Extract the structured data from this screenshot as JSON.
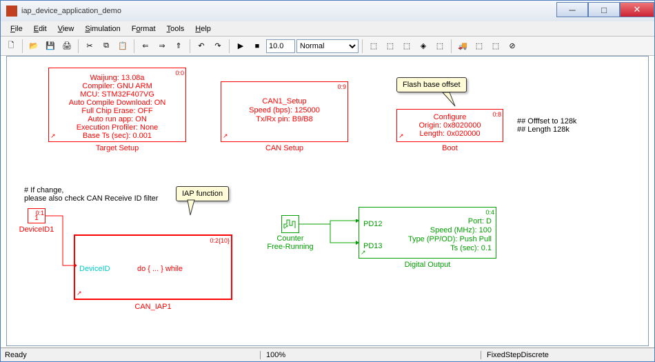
{
  "window": {
    "title": "iap_device_application_demo"
  },
  "menu": {
    "file": "File",
    "edit": "Edit",
    "view": "View",
    "simulation": "Simulation",
    "format": "Format",
    "tools": "Tools",
    "help": "Help"
  },
  "toolbar": {
    "simtime": "10.0",
    "mode": "Normal"
  },
  "status": {
    "ready": "Ready",
    "percent": "100%",
    "solver": "FixedStepDiscrete"
  },
  "blocks": {
    "target": {
      "idx": "0:0",
      "l1": "Waijung: 13.08a",
      "l2": "Compiler: GNU ARM",
      "l3": "MCU: STM32F407VG",
      "l4": "Auto Compile Download: ON",
      "l5": "Full Chip Erase: OFF",
      "l6": "Auto run app: ON",
      "l7": "Execution Profiler: None",
      "l8": "Base Ts (sec): 0.001",
      "label": "Target Setup"
    },
    "can": {
      "idx": "0:9",
      "l1": "CAN1_Setup",
      "l2": "Speed (bps): 125000",
      "l3": "Tx/Rx pin: B9/B8",
      "label": "CAN Setup"
    },
    "boot": {
      "idx": "0:8",
      "l1": "Configure",
      "l2": "Origin: 0x8020000",
      "l3": "Length: 0x020000",
      "label": "Boot"
    },
    "bootnote": {
      "l1": "## Offfset to 128k",
      "l2": "## Length 128k"
    },
    "callout1": "Flash base offset",
    "note1": {
      "l1": "# If change,",
      "l2": "please also check CAN Receive ID filter"
    },
    "deviceid": {
      "idx": "0:1",
      "val": "1",
      "label": "DeviceID1"
    },
    "callout2": "IAP function",
    "caniap": {
      "idx": "0:2{10}",
      "port": "DeviceID",
      "body": "do { ... } while",
      "label": "CAN_IAP1"
    },
    "counter": {
      "l1": "Counter",
      "l2": "Free-Running"
    },
    "digout": {
      "idx": "0:4",
      "p1": "PD12",
      "p2": "PD13",
      "r1": "Port: D",
      "r2": "Speed (MHz): 100",
      "r3": "Type (PP/OD): Push Pull",
      "r4": "Ts (sec): 0.1",
      "label": "Digital Output"
    }
  }
}
